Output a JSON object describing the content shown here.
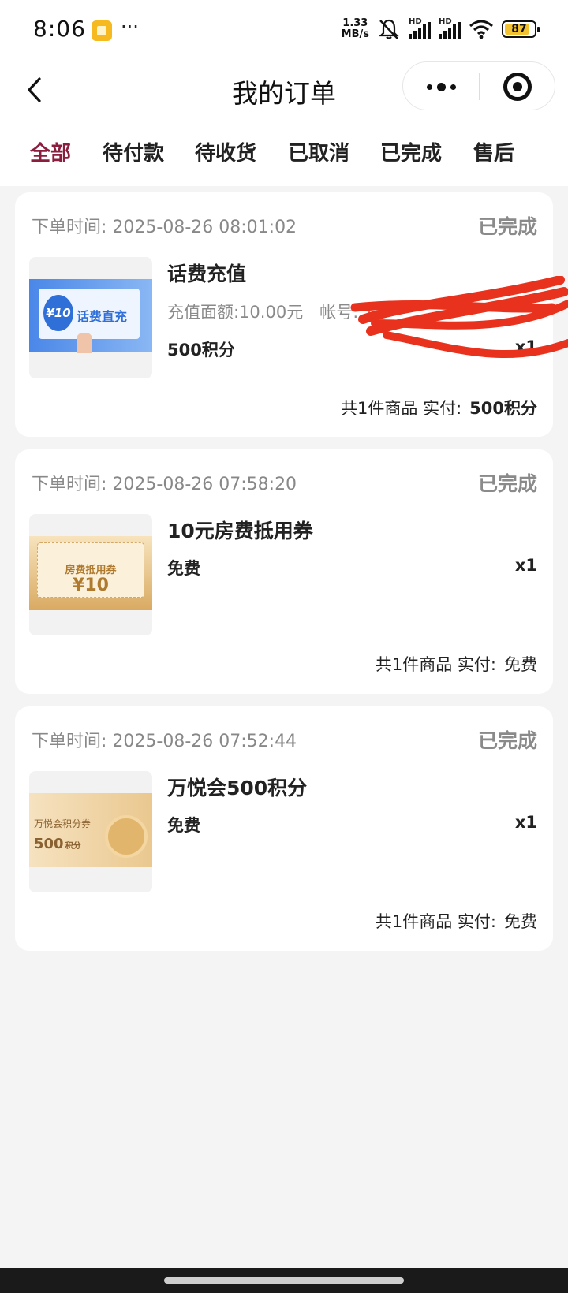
{
  "status_bar": {
    "time": "8:06",
    "dots": "···",
    "net_speed_value": "1.33",
    "net_speed_unit": "MB/s",
    "hd1": "HD",
    "hd2": "HD",
    "battery": "87",
    "battery_level": 0.87,
    "icons": [
      "app-notification-icon",
      "bell-muted-icon",
      "signal-icon",
      "wifi-icon",
      "battery-icon"
    ]
  },
  "nav": {
    "title": "我的订单",
    "icons": [
      "back-arrow-icon",
      "more-dots-icon",
      "target-close-icon"
    ]
  },
  "tabs": [
    {
      "label": "全部",
      "active": true
    },
    {
      "label": "待付款",
      "active": false
    },
    {
      "label": "待收货",
      "active": false
    },
    {
      "label": "已取消",
      "active": false
    },
    {
      "label": "已完成",
      "active": false
    },
    {
      "label": "售后",
      "active": false
    }
  ],
  "orders": [
    {
      "time_label": "下单时间: 2025-08-26 08:01:02",
      "status": "已完成",
      "thumb_text": "话费直充",
      "thumb_badge": "¥10",
      "name": "话费充值",
      "spec": "充值面额:10.00元　帐号: 1",
      "price": "500积分",
      "qty": "x1",
      "summary_count": "共1件商品 实付:",
      "summary_paid": "500积分"
    },
    {
      "time_label": "下单时间: 2025-08-26 07:58:20",
      "status": "已完成",
      "thumb_text": "房费抵用券",
      "thumb_badge": "¥10",
      "name": "10元房费抵用券",
      "price": "免费",
      "qty": "x1",
      "summary_count": "共1件商品 实付:",
      "summary_paid": "免费"
    },
    {
      "time_label": "下单时间: 2025-08-26 07:52:44",
      "status": "已完成",
      "thumb_text": "万悦会积分券",
      "thumb_badge": "500",
      "thumb_badge_unit": "积分",
      "name": "万悦会500积分",
      "price": "免费",
      "qty": "x1",
      "summary_count": "共1件商品 实付:",
      "summary_paid": "免费"
    }
  ],
  "colors": {
    "accent": "#8b1e3f",
    "status_gray": "#8a8a8a",
    "background": "#f4f4f5",
    "redaction": "#e8321e"
  }
}
